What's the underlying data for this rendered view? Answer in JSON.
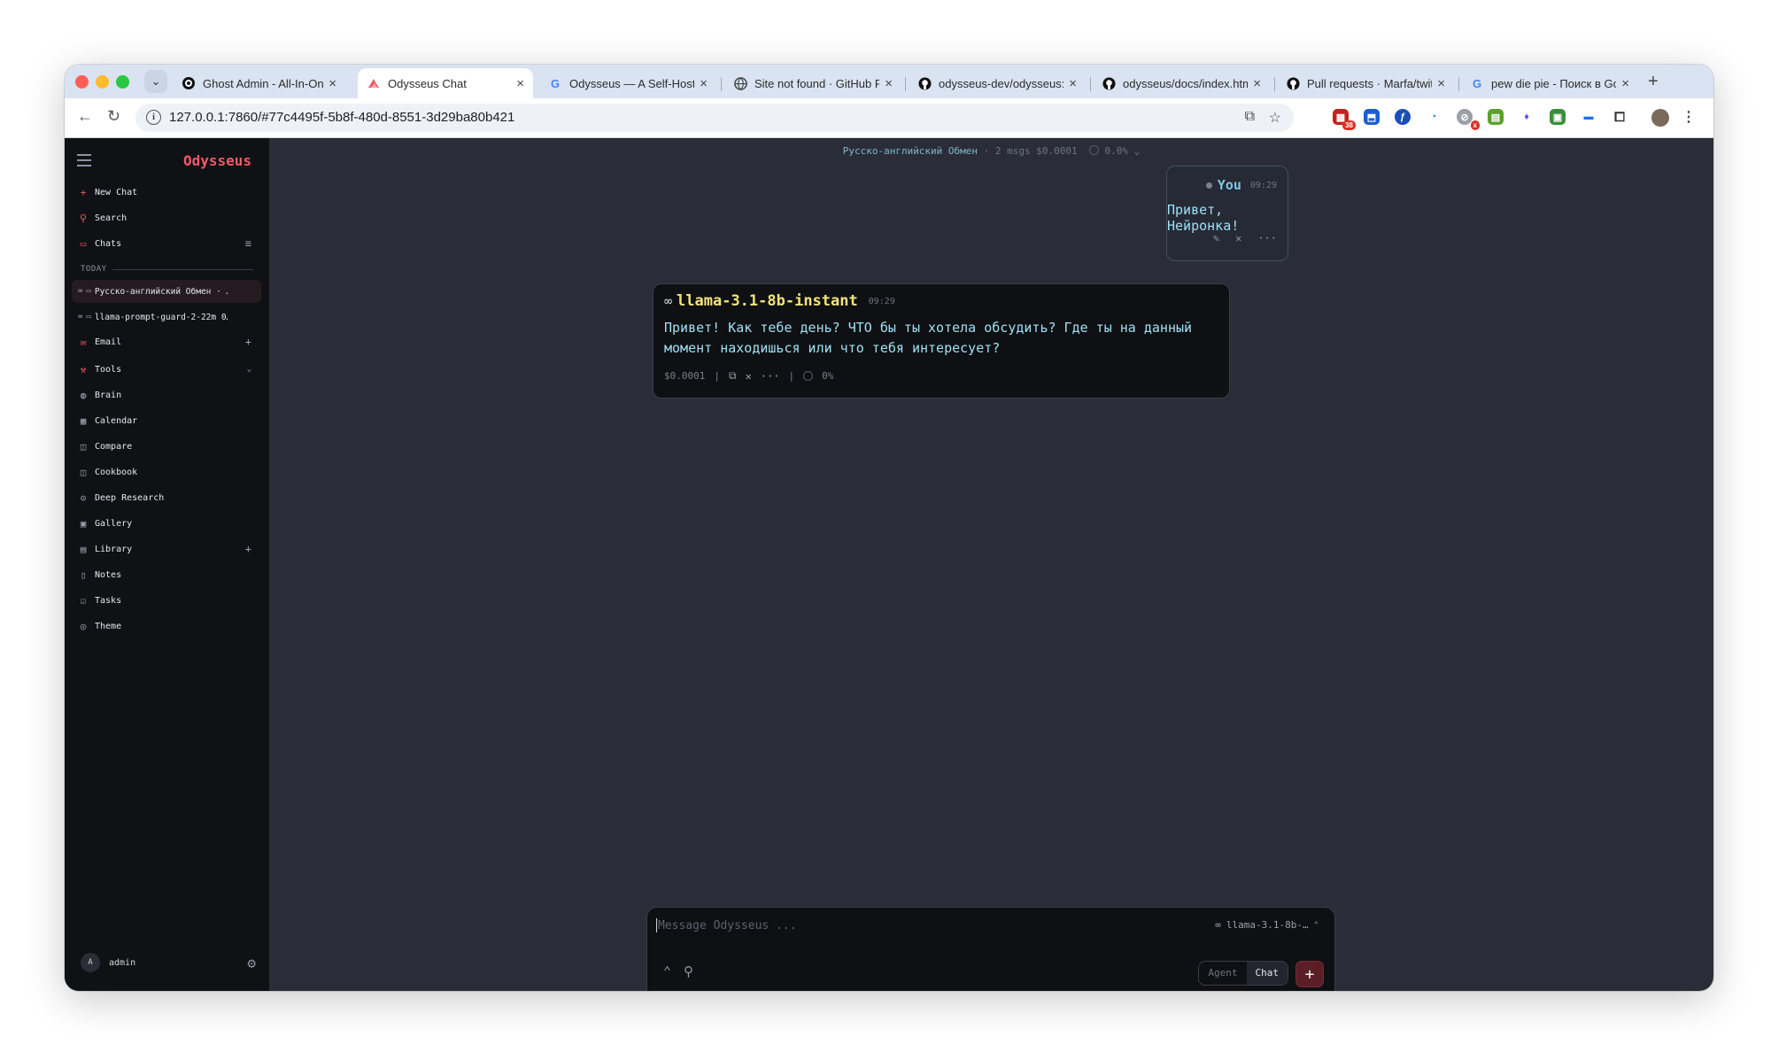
{
  "browser": {
    "tabs": [
      {
        "title": "Ghost Admin - All-In-One",
        "favicon": "ghost-icon"
      },
      {
        "title": "Odysseus Chat",
        "favicon": "odysseus-icon",
        "active": true
      },
      {
        "title": "Odysseus — A Self-Hoste",
        "favicon": "google-icon"
      },
      {
        "title": "Site not found · GitHub P",
        "favicon": "globe-icon"
      },
      {
        "title": "odysseus-dev/odysseus:",
        "favicon": "github-icon"
      },
      {
        "title": "odysseus/docs/index.htm",
        "favicon": "github-icon"
      },
      {
        "title": "Pull requests · Marfa/twit",
        "favicon": "github-icon"
      },
      {
        "title": "pew die pie - Поиск в Go",
        "favicon": "google-icon"
      }
    ],
    "url": "127.0.0.1:7860/#77c4495f-5b8f-480d-8551-3d29ba80b421",
    "extension_badge_count": "38",
    "extension_badge_x": "x"
  },
  "sidebar": {
    "logo": "Odysseus",
    "new_chat": "New Chat",
    "search": "Search",
    "chats": "Chats",
    "section_today": "TODAY",
    "chat_items": [
      {
        "title": "Русско-английский Обмен · …",
        "active": true
      },
      {
        "title": "llama-prompt-guard-2-22m 0…"
      }
    ],
    "email": "Email",
    "tools": "Tools",
    "tool_items": [
      "Brain",
      "Calendar",
      "Compare",
      "Cookbook",
      "Deep Research",
      "Gallery",
      "Library",
      "Notes",
      "Tasks",
      "Theme"
    ],
    "user": {
      "avatar_letter": "A",
      "name": "admin"
    }
  },
  "header": {
    "title": "Русско-английский Обмен",
    "meta": "· 2 msgs",
    "cost": "$0.0001",
    "percent": "0.0%"
  },
  "messages": {
    "user": {
      "author": "You",
      "time": "09:29",
      "text": "Привет, Нейронка!"
    },
    "assistant": {
      "model": "llama-3.1-8b-instant",
      "time": "09:29",
      "text": "Привет! Как тебе день? ЧТО бы ты хотела обсудить? Где ты на данный момент находишься или что тебя интересует?",
      "cost": "$0.0001",
      "percent": "0%"
    }
  },
  "composer": {
    "placeholder": "Message Odysseus ...",
    "model": "llama-3.1-8b-…",
    "mode_agent": "Agent",
    "mode_chat": "Chat",
    "send_label": "+"
  },
  "colors": {
    "accent": "#ef5a6a",
    "sidebar_bg": "#101114",
    "main_bg": "#2a2d38",
    "user_text": "#9fe0f2",
    "model_name": "#f2e37a"
  }
}
